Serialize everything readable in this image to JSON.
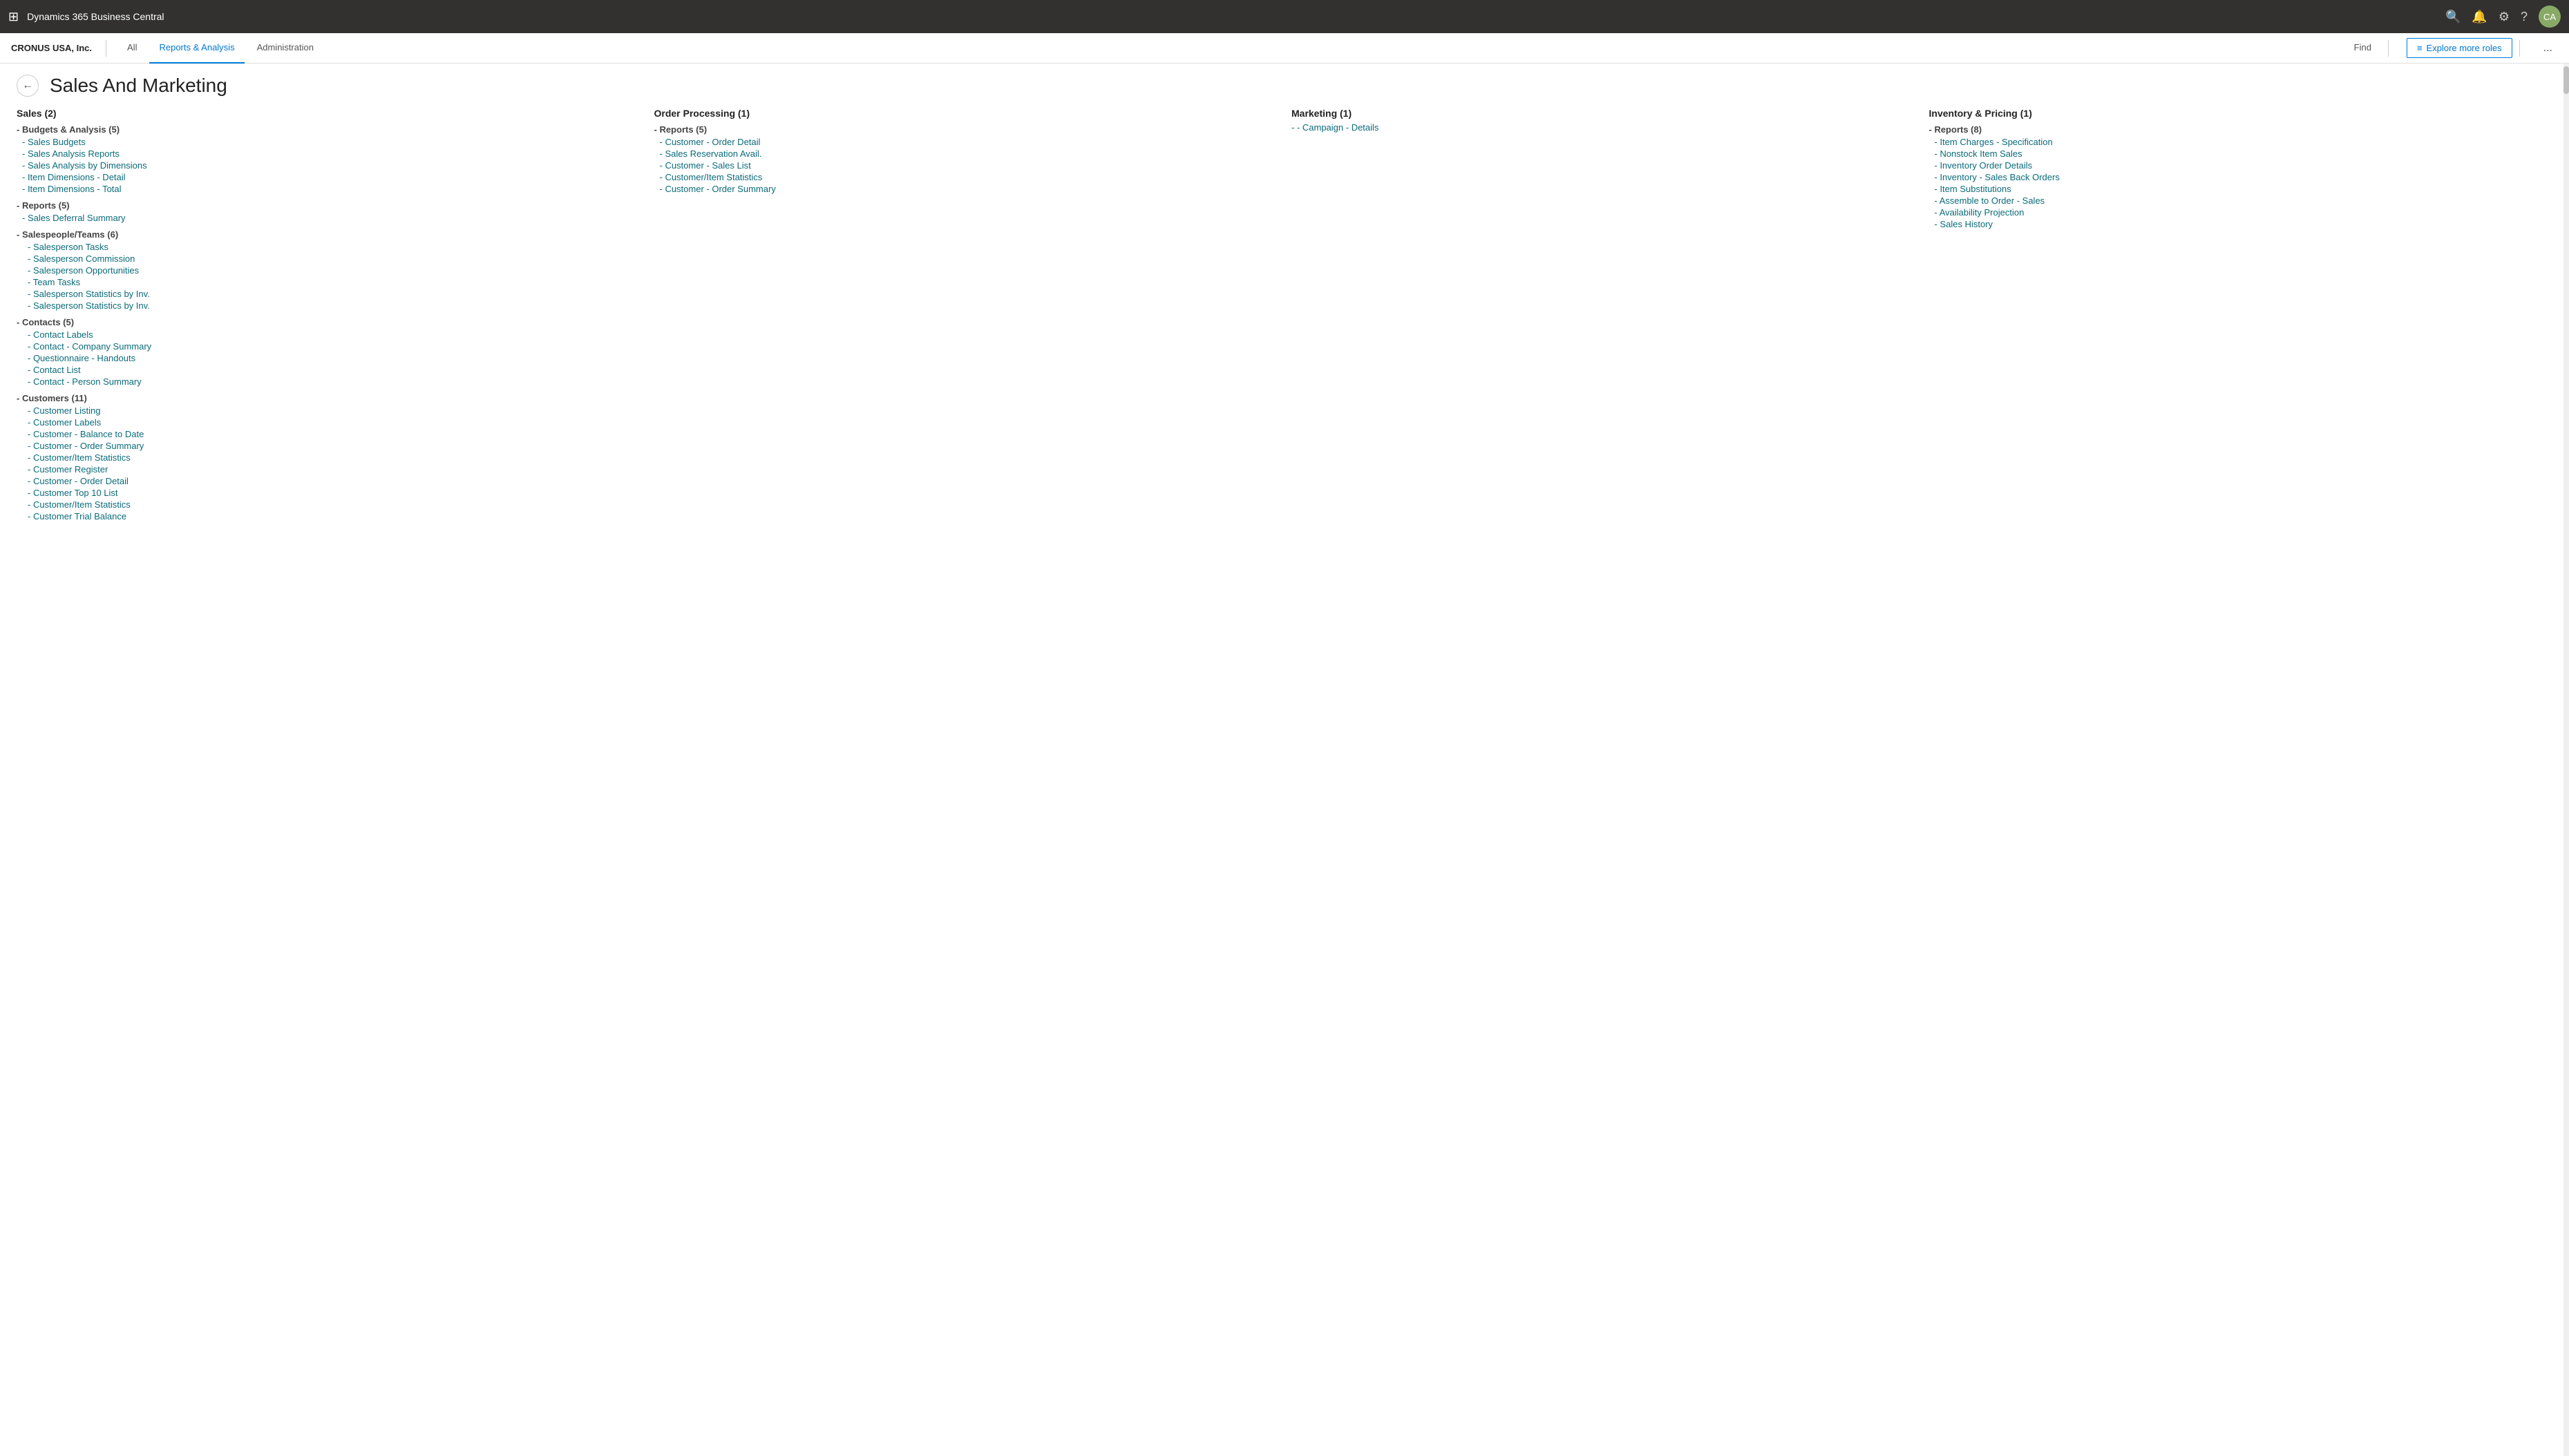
{
  "topbar": {
    "waffle_icon": "⊞",
    "title": "Dynamics 365 Business Central",
    "search_icon": "🔍",
    "bell_icon": "🔔",
    "gear_icon": "⚙",
    "help_icon": "?",
    "avatar_initials": "CA"
  },
  "subnav": {
    "company": "CRONUS USA, Inc.",
    "tabs": [
      {
        "label": "All",
        "active": false
      },
      {
        "label": "Reports & Analysis",
        "active": true
      },
      {
        "label": "Administration",
        "active": false
      }
    ],
    "find_label": "Find",
    "explore_icon": "≡",
    "explore_label": "Explore more roles",
    "more_label": "..."
  },
  "page": {
    "back_arrow": "←",
    "title": "Sales And Marketing"
  },
  "columns": [
    {
      "id": "sales",
      "header": "Sales",
      "header_count": "(2)",
      "items": [
        {
          "type": "subsection",
          "label": "- Budgets & Analysis",
          "count": "(5)",
          "indent": 0
        },
        {
          "type": "link",
          "label": "Sales Budgets",
          "indent": 1
        },
        {
          "type": "link",
          "label": "Sales Analysis Reports",
          "indent": 1
        },
        {
          "type": "link",
          "label": "Sales Analysis by Dimensions",
          "indent": 1
        },
        {
          "type": "link",
          "label": "Item Dimensions - Detail",
          "indent": 1
        },
        {
          "type": "link",
          "label": "Item Dimensions - Total",
          "indent": 1
        },
        {
          "type": "subsection",
          "label": "- Reports",
          "count": "(5)",
          "indent": 0
        },
        {
          "type": "link",
          "label": "Sales Deferral Summary",
          "indent": 1
        },
        {
          "type": "subsection",
          "label": "- Salespeople/Teams",
          "count": "(6)",
          "indent": 0
        },
        {
          "type": "link",
          "label": "Salesperson Tasks",
          "indent": 2
        },
        {
          "type": "link",
          "label": "Salesperson Commission",
          "indent": 2
        },
        {
          "type": "link",
          "label": "Salesperson Opportunities",
          "indent": 2
        },
        {
          "type": "link",
          "label": "Team Tasks",
          "indent": 2
        },
        {
          "type": "link",
          "label": "Salesperson Statistics by Inv.",
          "indent": 2
        },
        {
          "type": "link",
          "label": "Salesperson Statistics by Inv.",
          "indent": 2
        },
        {
          "type": "subsection",
          "label": "- Contacts",
          "count": "(5)",
          "indent": 0
        },
        {
          "type": "link",
          "label": "Contact Labels",
          "indent": 2
        },
        {
          "type": "link",
          "label": "Contact - Company Summary",
          "indent": 2
        },
        {
          "type": "link",
          "label": "Questionnaire - Handouts",
          "indent": 2
        },
        {
          "type": "link",
          "label": "Contact List",
          "indent": 2
        },
        {
          "type": "link",
          "label": "Contact - Person Summary",
          "indent": 2
        },
        {
          "type": "subsection",
          "label": "- Customers",
          "count": "(11)",
          "indent": 0
        },
        {
          "type": "link",
          "label": "Customer Listing",
          "indent": 2
        },
        {
          "type": "link",
          "label": "Customer Labels",
          "indent": 2
        },
        {
          "type": "link",
          "label": "Customer - Balance to Date",
          "indent": 2
        },
        {
          "type": "link",
          "label": "Customer - Order Summary",
          "indent": 2
        },
        {
          "type": "link",
          "label": "Customer/Item Statistics",
          "indent": 2
        },
        {
          "type": "link",
          "label": "Customer Register",
          "indent": 2
        },
        {
          "type": "link",
          "label": "Customer - Order Detail",
          "indent": 2
        },
        {
          "type": "link",
          "label": "Customer Top 10 List",
          "indent": 2
        },
        {
          "type": "link",
          "label": "Customer/Item Statistics",
          "indent": 2
        },
        {
          "type": "link",
          "label": "Customer Trial Balance",
          "indent": 2
        }
      ]
    },
    {
      "id": "order_processing",
      "header": "Order Processing",
      "header_count": "(1)",
      "items": [
        {
          "type": "subsection",
          "label": "- Reports",
          "count": "(5)",
          "indent": 0
        },
        {
          "type": "link",
          "label": "Customer - Order Detail",
          "indent": 1
        },
        {
          "type": "link",
          "label": "Sales Reservation Avail.",
          "indent": 1
        },
        {
          "type": "link",
          "label": "Customer - Sales List",
          "indent": 1
        },
        {
          "type": "link",
          "label": "Customer/Item Statistics",
          "indent": 1
        },
        {
          "type": "link",
          "label": "Customer - Order Summary",
          "indent": 1
        }
      ]
    },
    {
      "id": "marketing",
      "header": "Marketing",
      "header_count": "(1)",
      "items": [
        {
          "type": "link",
          "label": "- Campaign - Details",
          "indent": 0
        }
      ]
    },
    {
      "id": "inventory_pricing",
      "header": "Inventory & Pricing",
      "header_count": "(1)",
      "items": [
        {
          "type": "subsection",
          "label": "- Reports",
          "count": "(8)",
          "indent": 0
        },
        {
          "type": "link",
          "label": "Item Charges - Specification",
          "indent": 1
        },
        {
          "type": "link",
          "label": "Nonstock Item Sales",
          "indent": 1
        },
        {
          "type": "link",
          "label": "Inventory Order Details",
          "indent": 1
        },
        {
          "type": "link",
          "label": "Inventory - Sales Back Orders",
          "indent": 1
        },
        {
          "type": "link",
          "label": "Item Substitutions",
          "indent": 1
        },
        {
          "type": "link",
          "label": "Assemble to Order - Sales",
          "indent": 1
        },
        {
          "type": "link",
          "label": "Availability Projection",
          "indent": 1
        },
        {
          "type": "link",
          "label": "Sales History",
          "indent": 1
        }
      ]
    }
  ]
}
